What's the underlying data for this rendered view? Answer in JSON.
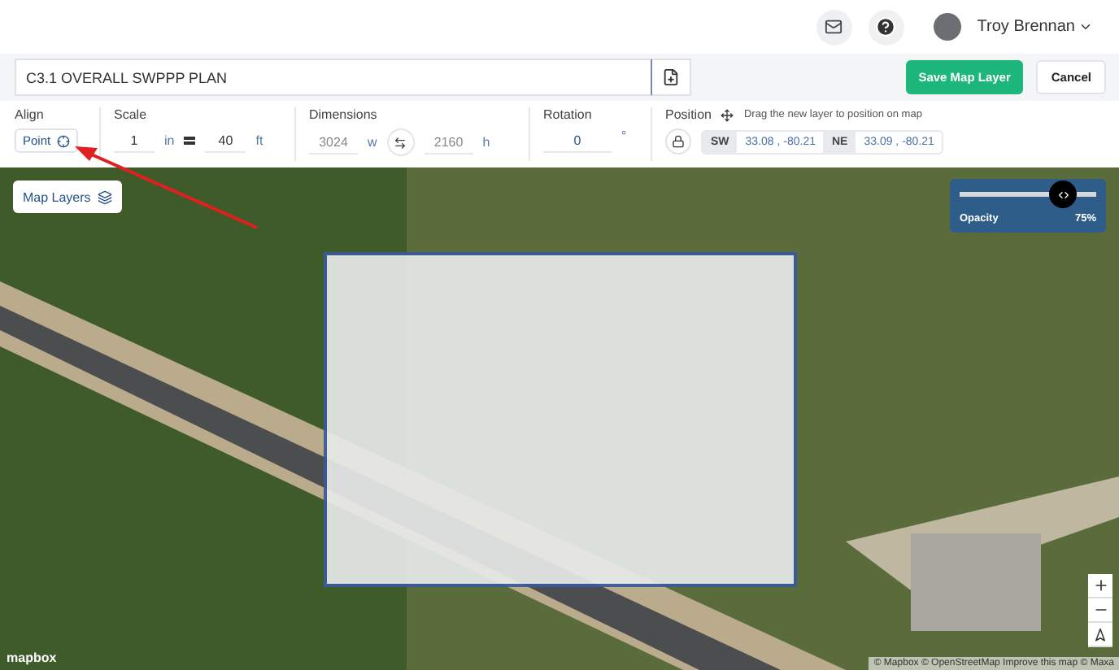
{
  "header": {
    "user_name": "Troy Brennan"
  },
  "layer_bar": {
    "name_value": "C3.1 OVERALL SWPPP PLAN",
    "save_label": "Save Map Layer",
    "cancel_label": "Cancel"
  },
  "toolbar": {
    "align": {
      "label": "Align",
      "value": "Point"
    },
    "scale": {
      "label": "Scale",
      "left_value": "1",
      "left_unit": "in",
      "right_value": "40",
      "right_unit": "ft"
    },
    "dimensions": {
      "label": "Dimensions",
      "width_value": "3024",
      "width_unit": "w",
      "height_value": "2160",
      "height_unit": "h"
    },
    "rotation": {
      "label": "Rotation",
      "value": "0",
      "unit": "°"
    },
    "position": {
      "label": "Position",
      "hint": "Drag the new layer to position on map",
      "locked": true,
      "corners": [
        {
          "tag": "SW",
          "value": "33.08 , -80.21"
        },
        {
          "tag": "NE",
          "value": "33.09 , -80.21"
        }
      ]
    }
  },
  "map": {
    "layers_label": "Map Layers",
    "opacity": {
      "label": "Opacity",
      "reading": "75%",
      "level": 0.75
    },
    "logo": "mapbox",
    "attribution": "© Mapbox © OpenStreetMap Improve this map © Maxa"
  }
}
